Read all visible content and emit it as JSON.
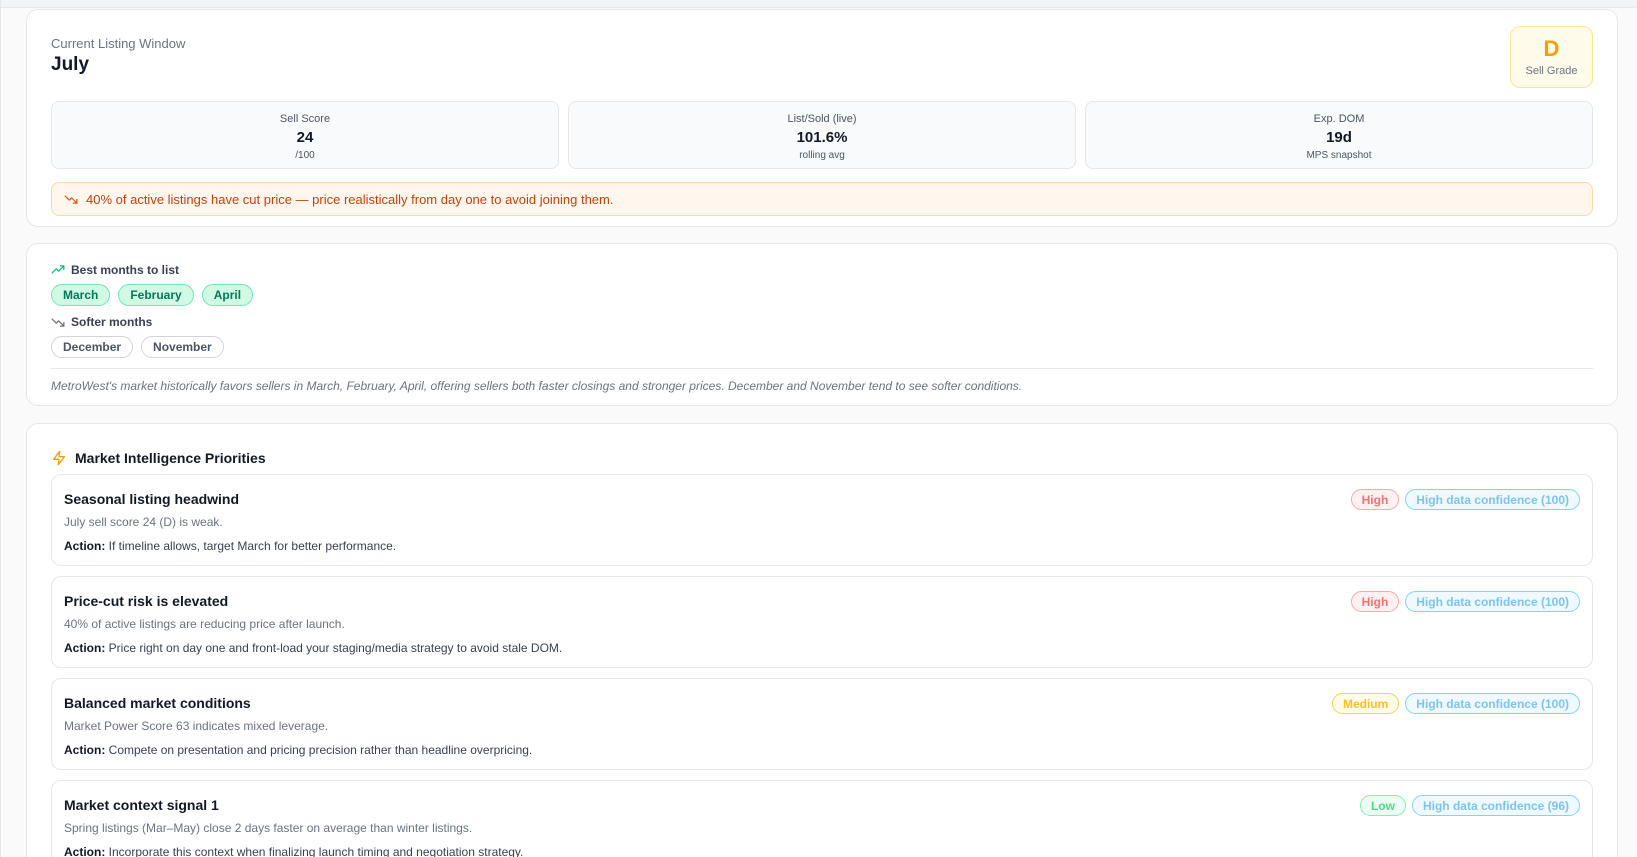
{
  "listing_window": {
    "label": "Current Listing Window",
    "month": "July",
    "grade": {
      "letter": "D",
      "caption": "Sell Grade",
      "color": "#f59e0b"
    },
    "stats": [
      {
        "label": "Sell Score",
        "value": "24",
        "sub": "/100"
      },
      {
        "label": "List/Sold (live)",
        "value": "101.6%",
        "sub": "rolling avg"
      },
      {
        "label": "Exp. DOM",
        "value": "19d",
        "sub": "MPS snapshot"
      }
    ],
    "alert": {
      "icon": "trending-down-icon",
      "text": "40% of active listings have cut price — price realistically from day one to avoid joining them."
    }
  },
  "seasonal": {
    "best_heading": "Best months to list",
    "best_icon": "trending-up-icon",
    "best_months": [
      "March",
      "February",
      "April"
    ],
    "softer_heading": "Softer months",
    "softer_icon": "trending-down-icon",
    "softer_months": [
      "December",
      "November"
    ],
    "note": "MetroWest's market historically favors sellers in March, February, April, offering sellers both faster closings and stronger prices. December and November tend to see softer conditions."
  },
  "priorities": {
    "heading": "Market Intelligence Priorities",
    "heading_icon": "lightning-icon",
    "action_prefix": "Action:",
    "items": [
      {
        "title": "Seasonal listing headwind",
        "description": "July sell score 24 (D) is weak.",
        "action": "If timeline allows, target March for better performance.",
        "priority": "High",
        "confidence": "High data confidence (100)"
      },
      {
        "title": "Price-cut risk is elevated",
        "description": "40% of active listings are reducing price after launch.",
        "action": "Price right on day one and front-load your staging/media strategy to avoid stale DOM.",
        "priority": "High",
        "confidence": "High data confidence (100)"
      },
      {
        "title": "Balanced market conditions",
        "description": "Market Power Score 63 indicates mixed leverage.",
        "action": "Compete on presentation and pricing precision rather than headline overpricing.",
        "priority": "Medium",
        "confidence": "High data confidence (100)"
      },
      {
        "title": "Market context signal 1",
        "description": "Spring listings (Mar–May) close 2 days faster on average than winter listings.",
        "action": "Incorporate this context when finalizing launch timing and negotiation strategy.",
        "priority": "Low",
        "confidence": "High data confidence (96)"
      }
    ]
  }
}
